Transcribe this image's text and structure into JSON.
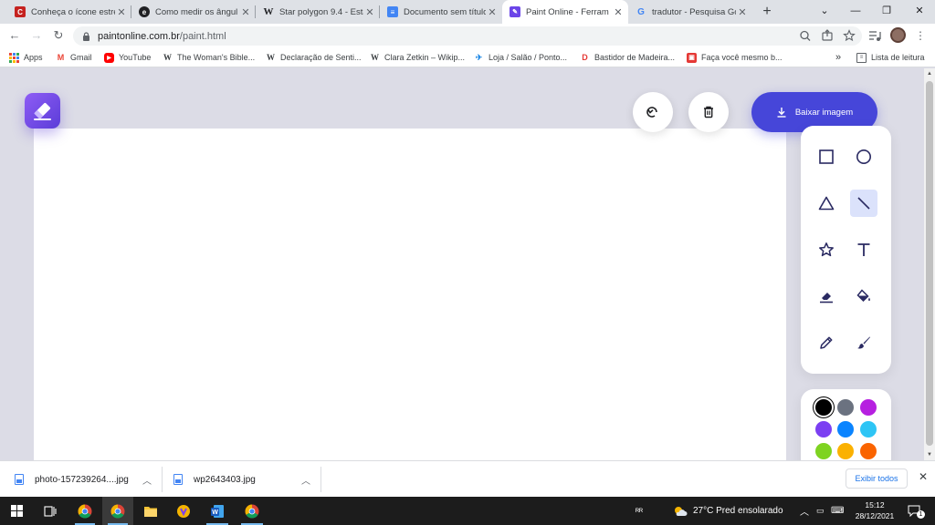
{
  "tabs": [
    {
      "title": "Conheça o ícone estre",
      "fav_color": "#c5221f",
      "fav_glyph": "C",
      "active": false
    },
    {
      "title": "Como medir os ângul",
      "fav_color": "#202124",
      "fav_glyph": "e",
      "active": false
    },
    {
      "title": "Star polygon 9.4 - Esta",
      "fav_color": "#ffffff",
      "fav_glyph": "W",
      "active": false
    },
    {
      "title": "Documento sem título",
      "fav_color": "#4285f4",
      "fav_glyph": "≡",
      "active": false
    },
    {
      "title": "Paint Online - Ferram",
      "fav_color": "#6b45e8",
      "fav_glyph": "✎",
      "active": true
    },
    {
      "title": "tradutor - Pesquisa Go",
      "fav_color": "#ffffff",
      "fav_glyph": "G",
      "active": false
    }
  ],
  "window_controls": {
    "tab_search": "⌄",
    "minimize": "—",
    "restore": "❐",
    "close": "✕"
  },
  "address": {
    "host": "paintonline.com.br",
    "path": "/paint.html"
  },
  "bookmarks": [
    {
      "label": "Apps",
      "icon": "apps-grid-icon"
    },
    {
      "label": "Gmail",
      "icon": "gmail-icon"
    },
    {
      "label": "YouTube",
      "icon": "youtube-icon"
    },
    {
      "label": "The Woman's Bible...",
      "icon": "wikipedia-icon"
    },
    {
      "label": "Declaração de Senti...",
      "icon": "wikipedia-icon"
    },
    {
      "label": "Clara Zetkin – Wikip...",
      "icon": "wikipedia-icon"
    },
    {
      "label": "Loja / Salão / Ponto...",
      "icon": "bird-icon"
    },
    {
      "label": "Bastidor de Madeira...",
      "icon": "d-logo-icon"
    },
    {
      "label": "Faça você mesmo b...",
      "icon": "shop-icon"
    }
  ],
  "bookmarks_more": "»",
  "reading_list": "Lista de leitura",
  "app": {
    "download_label": "Baixar imagem",
    "tools": [
      {
        "name": "rectangle-tool",
        "icon": "square-icon",
        "selected": false
      },
      {
        "name": "circle-tool",
        "icon": "circle-icon",
        "selected": false
      },
      {
        "name": "triangle-tool",
        "icon": "triangle-icon",
        "selected": false
      },
      {
        "name": "line-tool",
        "icon": "line-icon",
        "selected": true
      },
      {
        "name": "star-tool",
        "icon": "star-icon",
        "selected": false
      },
      {
        "name": "text-tool",
        "icon": "text-icon",
        "selected": false
      },
      {
        "name": "eraser-tool",
        "icon": "eraser-icon",
        "selected": false
      },
      {
        "name": "fill-tool",
        "icon": "paint-bucket-icon",
        "selected": false
      },
      {
        "name": "pencil-tool",
        "icon": "pencil-icon",
        "selected": false
      },
      {
        "name": "brush-tool",
        "icon": "brush-icon",
        "selected": false
      }
    ],
    "colors": [
      "#000000",
      "#6b7280",
      "#b620e0",
      "#7b3ff2",
      "#0a84ff",
      "#2ec5f5",
      "#7ed321",
      "#fbb100",
      "#fa6400"
    ],
    "selected_color": "#000000",
    "accent_color": "#4646d9"
  },
  "downloads": [
    {
      "filename": "photo-157239264....jpg"
    },
    {
      "filename": "wp2643403.jpg"
    }
  ],
  "show_all_label": "Exibir todos",
  "taskbar": {
    "weather": "27°C  Pred ensolarado",
    "time": "15:12",
    "date": "28/12/2021",
    "notifications": "1"
  }
}
